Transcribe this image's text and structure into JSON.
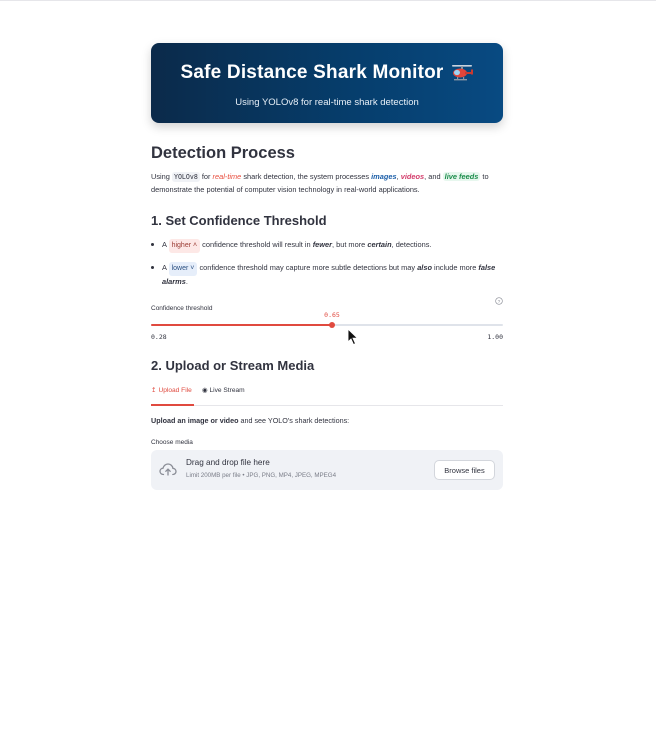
{
  "banner": {
    "title": "Safe Distance Shark Monitor",
    "subtitle": "Using YOLOv8 for real-time shark detection",
    "icon": "helicopter-icon"
  },
  "detection": {
    "heading": "Detection Process",
    "intro": {
      "p1": "Using",
      "model": "YOLOv8",
      "p2": "for",
      "realtime": "real-time",
      "p3": "shark detection, the system processes",
      "images": "images",
      "comma1": ",",
      "videos": "videos",
      "p4": ", and",
      "live": "live feeds",
      "p5": "to demonstrate the potential of computer vision technology in real-world applications."
    }
  },
  "threshold": {
    "heading": "1. Set Confidence Threshold",
    "point1": {
      "a": "A",
      "chip": "higher",
      "b": "confidence threshold will result in",
      "fewer": "fewer",
      "c": ", but more",
      "certain": "certain",
      "d": ", detections."
    },
    "point2": {
      "a": "A",
      "chip": "lower",
      "b": "confidence threshold may capture more subtle detections but may",
      "also": "also",
      "c": "include more",
      "false_alarms": "false alarms",
      "d": "."
    },
    "slider": {
      "label": "Confidence threshold",
      "value": 0.65,
      "value_text": "0.65",
      "min": 0.28,
      "max": 1.0,
      "min_text": "0.28",
      "max_text": "1.00"
    }
  },
  "upload": {
    "heading": "2. Upload or Stream Media",
    "tabs": [
      {
        "icon": "↥",
        "label": "Upload File",
        "active": true
      },
      {
        "icon": "◉",
        "label": "Live Stream",
        "active": false
      }
    ],
    "intro_bold": "Upload an image or video",
    "intro_rest": "and see YOLO's shark detections:",
    "file_label": "Choose media",
    "dropzone_title": "Drag and drop file here",
    "dropzone_sub": "Limit 200MB per file • JPG, PNG, MP4, JPEG, MPEG4",
    "browse_label": "Browse files"
  },
  "colors": {
    "accent": "#e04a3f",
    "banner_dark": "#0b2a4a",
    "banner_light": "#084a82"
  }
}
